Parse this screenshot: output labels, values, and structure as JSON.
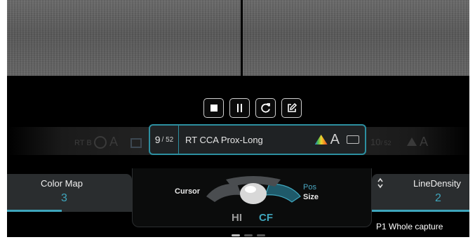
{
  "controls": {
    "stop_icon": "stop-icon",
    "pause_icon": "pause-icon",
    "refresh_icon": "refresh-icon",
    "edit_icon": "edit-icon"
  },
  "strip": {
    "ghost_left_text": "RT B",
    "ghost_right_num": "10",
    "ghost_right_total": "/ 52",
    "active_clip": {
      "number": "9",
      "total": "/ 52",
      "name": "RT CCA Prox-Long",
      "badge_letter": "A"
    }
  },
  "left_panel": {
    "label": "Color Map",
    "value": "3",
    "fill_fraction": 0.44
  },
  "right_panel": {
    "label": "LineDensity",
    "value": "2",
    "fill_fraction": 1.0
  },
  "trackball": {
    "left_label": "Cursor",
    "right_label_top": "Pos",
    "right_label_bottom": "Size",
    "mode_hi": "HI",
    "mode_cf": "CF"
  },
  "caption": "P1  Whole capture",
  "colors": {
    "accent": "#3fa6bd",
    "panel": "#2a2d2f",
    "background": "#000000"
  }
}
